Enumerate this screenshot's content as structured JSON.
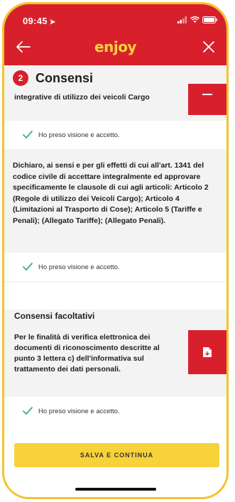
{
  "status": {
    "time": "09:45"
  },
  "nav": {
    "logo": "enjoy"
  },
  "section": {
    "step": "2",
    "title": "Consensi"
  },
  "doc_card_1": {
    "text": "integrative di utilizzo dei veicoli Cargo"
  },
  "check_1": {
    "label": "Ho preso visione e accetto."
  },
  "declaration": {
    "text": "Dichiaro, ai sensi e per gli effetti di cui all'art. 1341 del codice civile di accettare integralmente ed approvare specificamente le clausole di cui agli articoli: Articolo 2 (Regole di utilizzo dei Veicoli Cargo); Articolo 4 (Limitazioni al Trasporto di Cose); Articolo 5 (Tariffe e Penali); (Allegato Tariffe); (Allegato Penali)."
  },
  "check_2": {
    "label": "Ho preso visione e accetto."
  },
  "optional": {
    "heading": "Consensi facoltativi"
  },
  "doc_card_2": {
    "text": "Per le finalità di verifica elettronica dei documenti di riconoscimento descritte al punto 3 lettera c) dell'informativa sul trattamento dei dati personali."
  },
  "check_3": {
    "label": "Ho preso visione e accetto."
  },
  "save": {
    "label": "SALVA E CONTINUA"
  },
  "colors": {
    "brand_red": "#d8202d",
    "brand_yellow": "#f7d23a",
    "check_green": "#3bb273"
  }
}
